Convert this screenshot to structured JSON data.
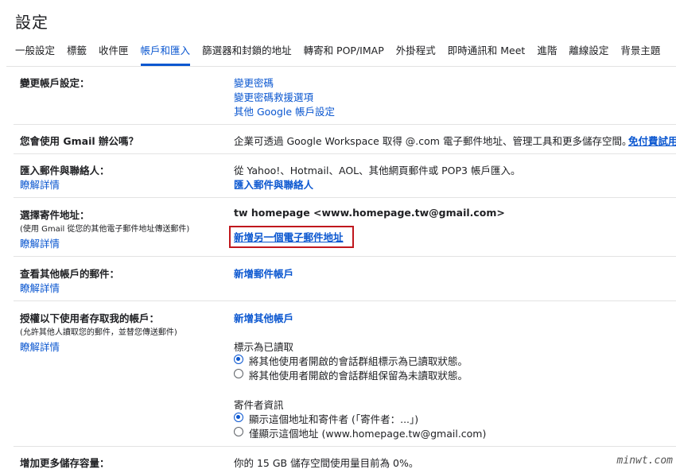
{
  "page_title": "設定",
  "tabs": [
    "一般設定",
    "標籤",
    "收件匣",
    "帳戶和匯入",
    "篩選器和封鎖的地址",
    "轉寄和 POP/IMAP",
    "外掛程式",
    "即時通訊和 Meet",
    "進階",
    "離線設定",
    "背景主題"
  ],
  "active_tab": "帳戶和匯入",
  "learn_more": "瞭解詳情",
  "change_account": {
    "label": "變更帳戶設定：",
    "links": [
      "變更密碼",
      "變更密碼救援選項",
      "其他 Google 帳戶設定"
    ]
  },
  "workspace": {
    "label": "您會使用 Gmail 辦公嗎？",
    "text": "企業可透過 Google Workspace 取得 @.com 電子郵件地址、管理工具和更多儲存空間。",
    "link": "免付費試用"
  },
  "import": {
    "label": "匯入郵件與聯絡人：",
    "text": "從 Yahoo!、Hotmail、AOL、其他網頁郵件或 POP3 帳戶匯入。",
    "link": "匯入郵件與聯絡人"
  },
  "send_as": {
    "label": "選擇寄件地址：",
    "sub": "(使用 Gmail 從您的其他電子郵件地址傳送郵件)",
    "address": "tw homepage <www.homepage.tw@gmail.com>",
    "add_link": "新增另一個電子郵件地址"
  },
  "check_mail": {
    "label": "查看其他帳戶的郵件：",
    "link": "新增郵件帳戶"
  },
  "grant_access": {
    "label": "授權以下使用者存取我的帳戶：",
    "sub": "(允許其他人讀取您的郵件，並替您傳送郵件)",
    "link": "新增其他帳戶",
    "mark_read_title": "標示為已讀取",
    "mark_read_options": [
      "將其他使用者開啟的會話群組標示為已讀取狀態。",
      "將其他使用者開啟的會話群組保留為未讀取狀態。"
    ],
    "sender_info_title": "寄件者資訊",
    "sender_info_options": [
      "顯示這個地址和寄件者 (「寄件者：...」)",
      "僅顯示這個地址 (www.homepage.tw@gmail.com)"
    ]
  },
  "storage": {
    "label": "增加更多儲存容量：",
    "text": "你的 15 GB 儲存空間使用量目前為 0%。"
  },
  "watermark": "minwt.com"
}
